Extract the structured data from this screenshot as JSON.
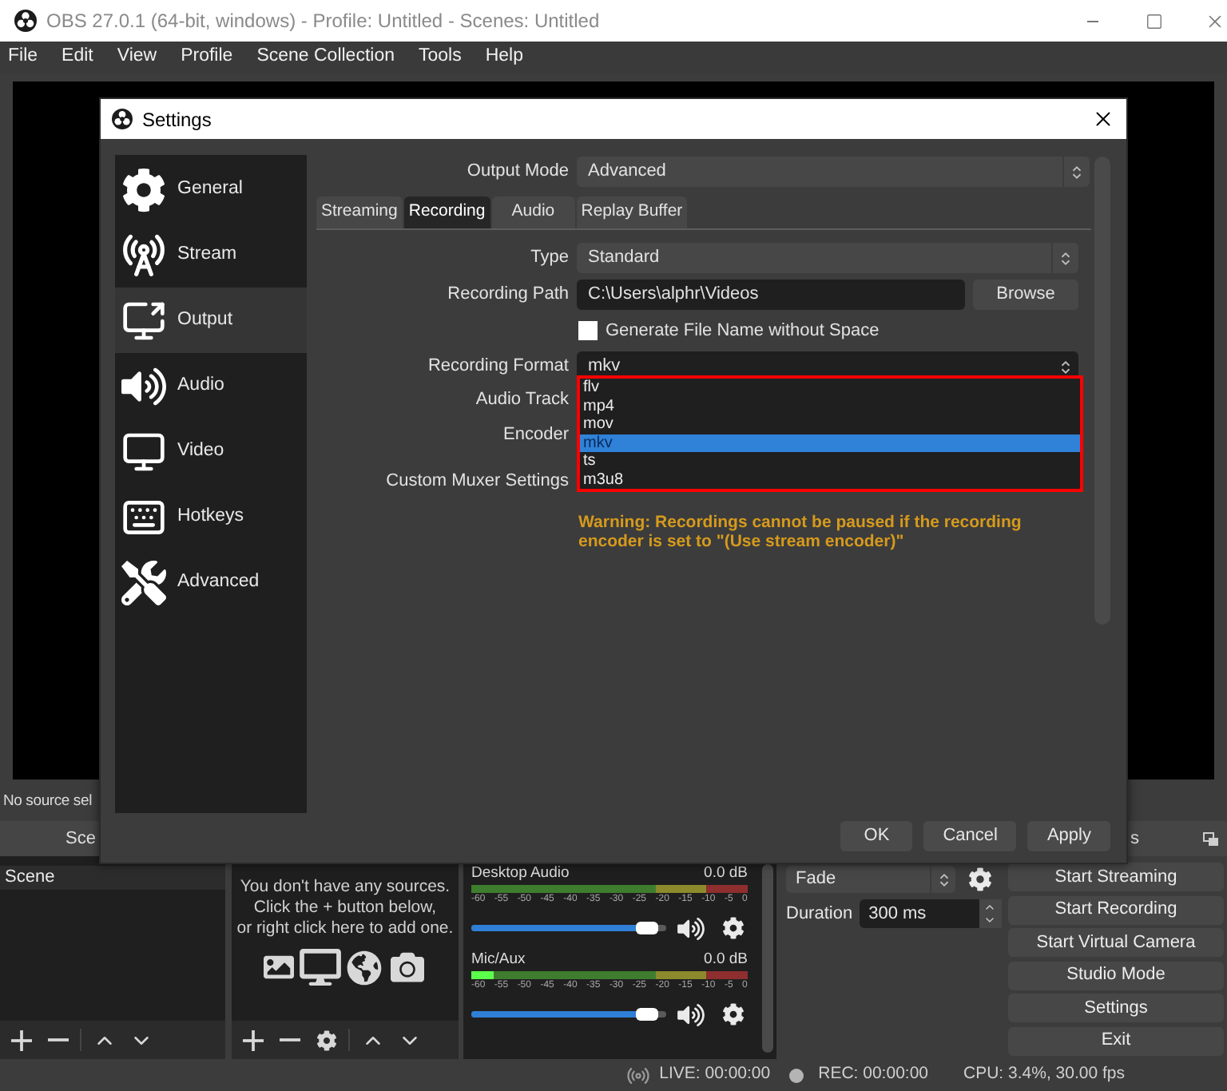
{
  "window": {
    "title": "OBS 27.0.1 (64-bit, windows) - Profile: Untitled - Scenes: Untitled"
  },
  "menu": [
    "File",
    "Edit",
    "View",
    "Profile",
    "Scene Collection",
    "Tools",
    "Help"
  ],
  "source_toolbar": {
    "text": "No source sel"
  },
  "dock_titles": {
    "scenes": "Sce",
    "controls": "s"
  },
  "scenes": {
    "items": [
      "Scene"
    ]
  },
  "sources": {
    "empty_message": "You don't have any sources.\nClick the + button below,\nor right click here to add one."
  },
  "audio_mixer": {
    "channels": [
      {
        "name": "Desktop Audio",
        "reading": "0.0 dB",
        "ticks": [
          "-60",
          "-55",
          "-50",
          "-45",
          "-40",
          "-35",
          "-30",
          "-25",
          "-20",
          "-15",
          "-10",
          "-5",
          "0"
        ],
        "volume": {
          "level": 0.95
        }
      },
      {
        "name": "Mic/Aux",
        "reading": "0.0 dB",
        "meter": {
          "level": 0.08
        },
        "ticks": [
          "-60",
          "-55",
          "-50",
          "-45",
          "-40",
          "-35",
          "-30",
          "-25",
          "-20",
          "-15",
          "-10",
          "-5",
          "0"
        ],
        "volume": {
          "level": 0.95
        }
      }
    ]
  },
  "transitions": {
    "type": "Fade",
    "duration_label": "Duration",
    "duration": "300 ms"
  },
  "controls": [
    "Start Streaming",
    "Start Recording",
    "Start Virtual Camera",
    "Studio Mode",
    "Settings",
    "Exit"
  ],
  "status_bar": {
    "live": "LIVE: 00:00:00",
    "rec": "REC: 00:00:00",
    "cpu": "CPU: 3.4%, 30.00 fps"
  },
  "settings": {
    "title": "Settings",
    "sidebar": [
      {
        "label": "General",
        "selected": false
      },
      {
        "label": "Stream",
        "selected": false
      },
      {
        "label": "Output",
        "selected": true
      },
      {
        "label": "Audio",
        "selected": false
      },
      {
        "label": "Video",
        "selected": false
      },
      {
        "label": "Hotkeys",
        "selected": false
      },
      {
        "label": "Advanced",
        "selected": false
      }
    ],
    "output_mode": {
      "label": "Output Mode",
      "value": "Advanced"
    },
    "tabs": [
      {
        "label": "Streaming",
        "selected": false
      },
      {
        "label": "Recording",
        "selected": true
      },
      {
        "label": "Audio",
        "selected": false
      },
      {
        "label": "Replay Buffer",
        "selected": false
      }
    ],
    "form": [
      {
        "kind": "select",
        "label": "Type",
        "value": "Standard",
        "expanded": false
      },
      {
        "kind": "path",
        "label": "Recording Path",
        "value": "C:\\Users\\alphr\\Videos",
        "button": "Browse"
      },
      {
        "kind": "checkbox",
        "label": "Generate File Name without Space",
        "checked": false
      },
      {
        "kind": "select",
        "label": "Recording Format",
        "value": "mkv",
        "expanded": true
      },
      {
        "kind": "label",
        "label": "Audio Track"
      },
      {
        "kind": "label",
        "label": "Encoder"
      },
      {
        "kind": "label",
        "label": "Custom Muxer Settings"
      }
    ],
    "format_options": [
      {
        "label": "flv",
        "selected": false
      },
      {
        "label": "mp4",
        "selected": false
      },
      {
        "label": "mov",
        "selected": false
      },
      {
        "label": "mkv",
        "selected": true
      },
      {
        "label": "ts",
        "selected": false
      },
      {
        "label": "m3u8",
        "selected": false
      }
    ],
    "warning": "Warning: Recordings cannot be paused if the recording\nencoder is set to \"(Use stream encoder)\"",
    "buttons": [
      "OK",
      "Cancel",
      "Apply"
    ]
  }
}
